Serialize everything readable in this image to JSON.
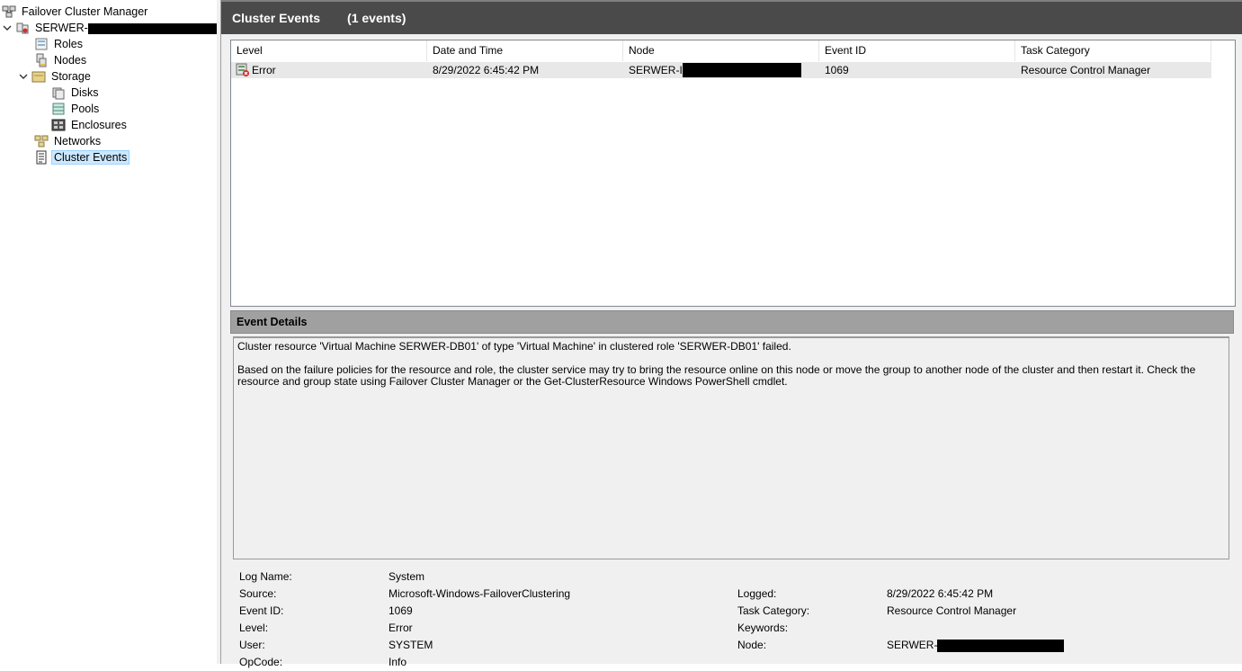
{
  "tree": {
    "root": "Failover Cluster Manager",
    "cluster": "SERWER-",
    "items": [
      {
        "label": "Roles"
      },
      {
        "label": "Nodes"
      },
      {
        "label": "Storage"
      },
      {
        "label": "Disks"
      },
      {
        "label": "Pools"
      },
      {
        "label": "Enclosures"
      },
      {
        "label": "Networks"
      },
      {
        "label": "Cluster Events"
      }
    ]
  },
  "header": {
    "title": "Cluster Events",
    "count": "(1 events)"
  },
  "grid": {
    "columns": [
      "Level",
      "Date and Time",
      "Node",
      "Event ID",
      "Task Category"
    ],
    "rows": [
      {
        "level": "Error",
        "datetime": "8/29/2022 6:45:42 PM",
        "node": "SERWER-I",
        "event_id": "1069",
        "task_category": "Resource Control Manager"
      }
    ]
  },
  "details": {
    "title": "Event Details",
    "message_line1": "Cluster resource 'Virtual Machine SERWER-DB01' of type 'Virtual Machine' in clustered role 'SERWER-DB01' failed.",
    "message_line2": "Based on the failure policies for the resource and role, the cluster service may try to bring the resource online on this node or move the group to another node of the cluster and then restart it.  Check the resource and group state using Failover Cluster Manager or the Get-ClusterResource Windows PowerShell cmdlet."
  },
  "properties": {
    "log_name_label": "Log Name:",
    "log_name": "System",
    "source_label": "Source:",
    "source": "Microsoft-Windows-FailoverClustering",
    "logged_label": "Logged:",
    "logged": "8/29/2022 6:45:42 PM",
    "event_id_label": "Event ID:",
    "event_id": "1069",
    "task_category_label": "Task Category:",
    "task_category": "Resource Control Manager",
    "level_label": "Level:",
    "level": "Error",
    "keywords_label": "Keywords:",
    "keywords": "",
    "user_label": "User:",
    "user": "SYSTEM",
    "node_label": "Node:",
    "node": "SERWER-",
    "opcode_label": "OpCode:",
    "opcode": "Info"
  },
  "icons": [
    "cluster-manager-icon",
    "cluster-icon",
    "roles-icon",
    "nodes-icon",
    "storage-icon",
    "disks-icon",
    "pools-icon",
    "enclosures-icon",
    "networks-icon",
    "cluster-events-icon",
    "error-event-icon"
  ]
}
